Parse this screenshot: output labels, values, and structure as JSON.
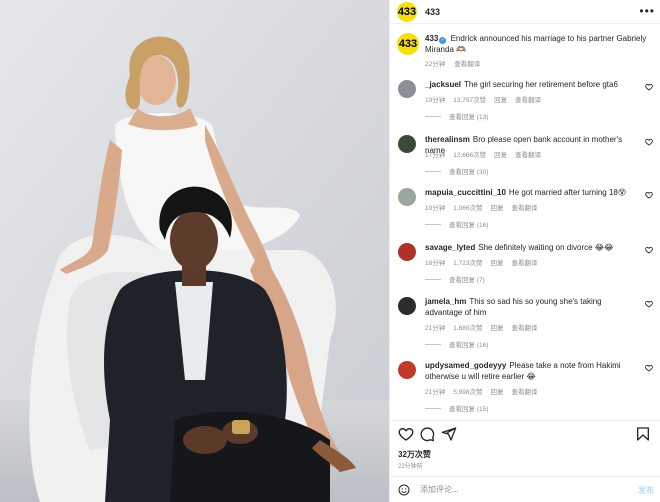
{
  "post": {
    "account": "433",
    "avatar_text": "433",
    "more_icon": "more-horizontal-icon",
    "caption": {
      "user": "433",
      "text": "Endrick announced his marriage to his partner Gabriely Miranda",
      "emoji": "🫶🏽",
      "time": "22分钟",
      "translate": "查看翻译"
    }
  },
  "comments": [
    {
      "user": "_jacksuel",
      "text": "The girl securing her retirement before gta6",
      "time": "19分钟",
      "likes": "13,797次赞",
      "reply": "回复",
      "translate": "查看翻译",
      "replies": "查看回复 (13)",
      "avatar_color": "#8a8f98"
    },
    {
      "user": "therealinsm",
      "text": "Bro please open bank account in mother's name",
      "time": "17分钟",
      "likes": "12,666次赞",
      "reply": "回复",
      "translate": "查看翻译",
      "replies": "查看回复 (30)",
      "avatar_color": "#3d4a3a"
    },
    {
      "user": "mapuia_cuccittini_10",
      "text": "He got married after turning 18😵",
      "time": "19分钟",
      "likes": "1,066次赞",
      "reply": "回复",
      "translate": "查看翻译",
      "replies": "查看回复 (16)",
      "avatar_color": "#9aa79c"
    },
    {
      "user": "savage_lyted",
      "text": "She definitely waiting on divorce 😂😂",
      "time": "18分钟",
      "likes": "1,723次赞",
      "reply": "回复",
      "translate": "查看翻译",
      "replies": "查看回复 (7)",
      "avatar_color": "#b0332b"
    },
    {
      "user": "jamela_hm",
      "text": "This so sad his so young she's taking advantage of him",
      "time": "21分钟",
      "likes": "1,680次赞",
      "reply": "回复",
      "translate": "查看翻译",
      "replies": "查看回复 (16)",
      "avatar_color": "#2c2c2c"
    },
    {
      "user": "updysamed_godeyyy",
      "text": "Please take a note from Hakimi otherwise u will retire earlier 😂",
      "time": "21分钟",
      "likes": "5,998次赞",
      "reply": "回复",
      "translate": "查看翻译",
      "replies": "查看回复 (15)",
      "avatar_color": "#c0392b"
    }
  ],
  "actions": {
    "like_icon": "heart-icon",
    "comment_icon": "comment-icon",
    "share_icon": "share-icon",
    "save_icon": "bookmark-icon"
  },
  "likes": "32万次赞",
  "post_time": "22分钟前",
  "comment_box": {
    "placeholder": "添加评论...",
    "post_label": "发布",
    "emoji_icon": "smiley-icon"
  },
  "colors": {
    "brand_yellow": "#f5df0a",
    "verified_blue": "#3897f0",
    "meta_gray": "#8e8e8e"
  }
}
